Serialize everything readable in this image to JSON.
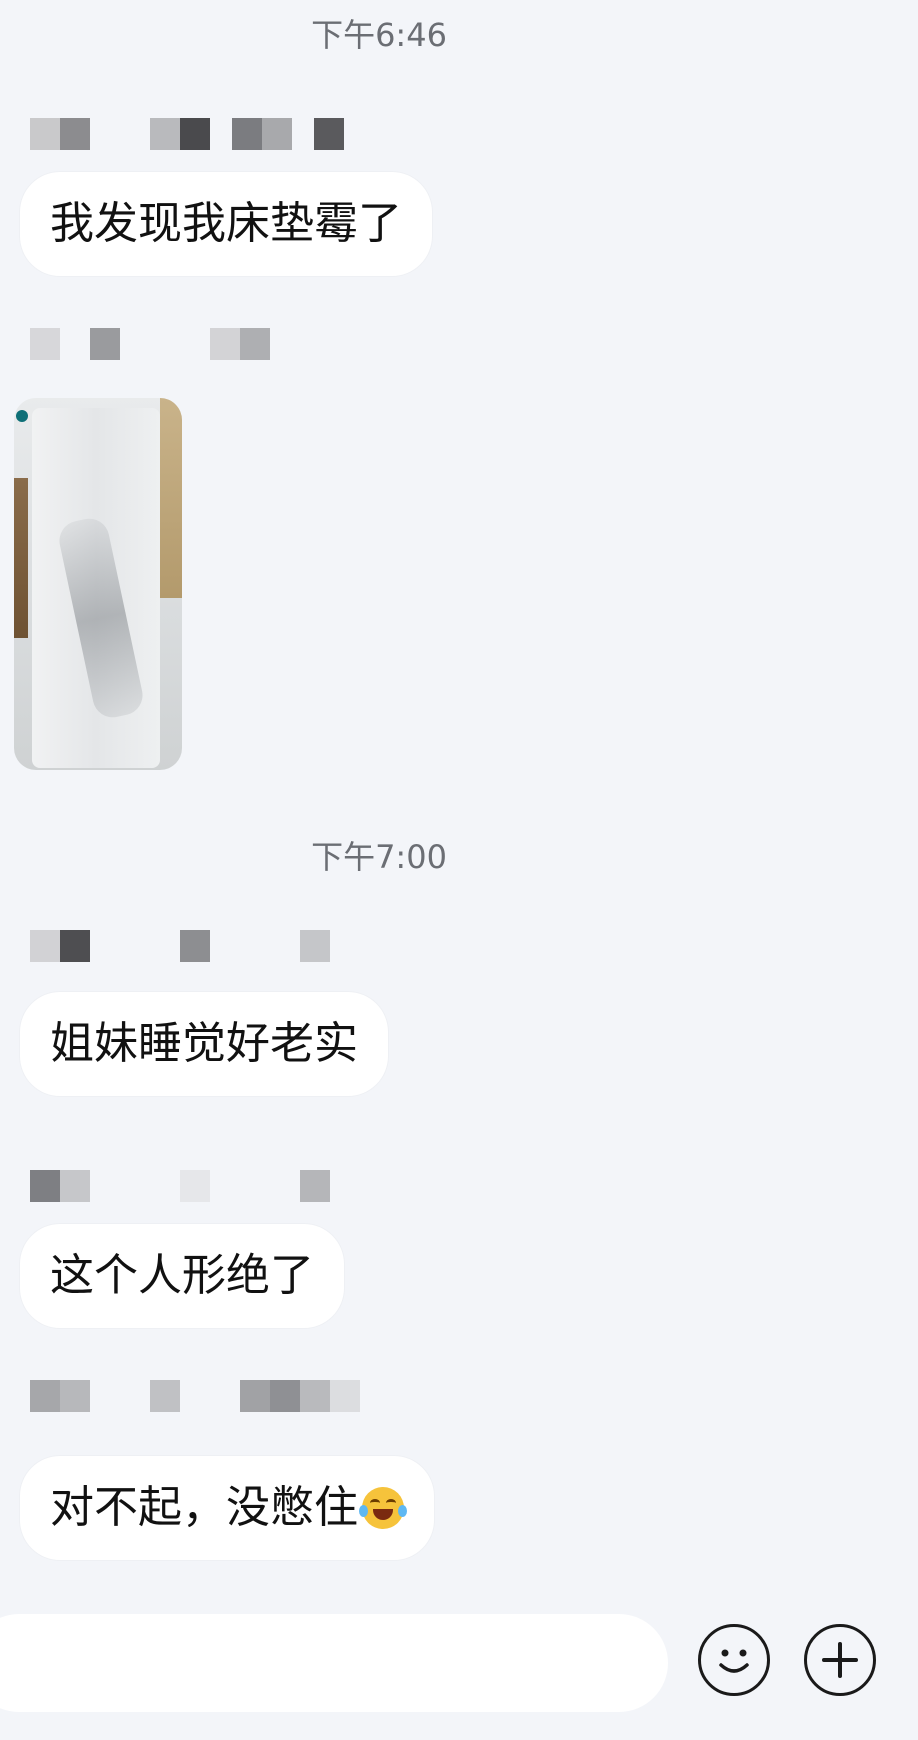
{
  "chat": {
    "time_1": "下午6:46",
    "time_2": "下午7:00",
    "messages": [
      {
        "text": "我发现我床垫霉了"
      },
      {
        "text": "姐妹睡觉好老实"
      },
      {
        "text": "这个人形绝了"
      },
      {
        "text": "对不起，没憋住"
      }
    ],
    "photo_icon": "mattress-photo"
  },
  "input_bar": {
    "emoji_icon": "smile-icon",
    "plus_icon": "plus-icon"
  }
}
